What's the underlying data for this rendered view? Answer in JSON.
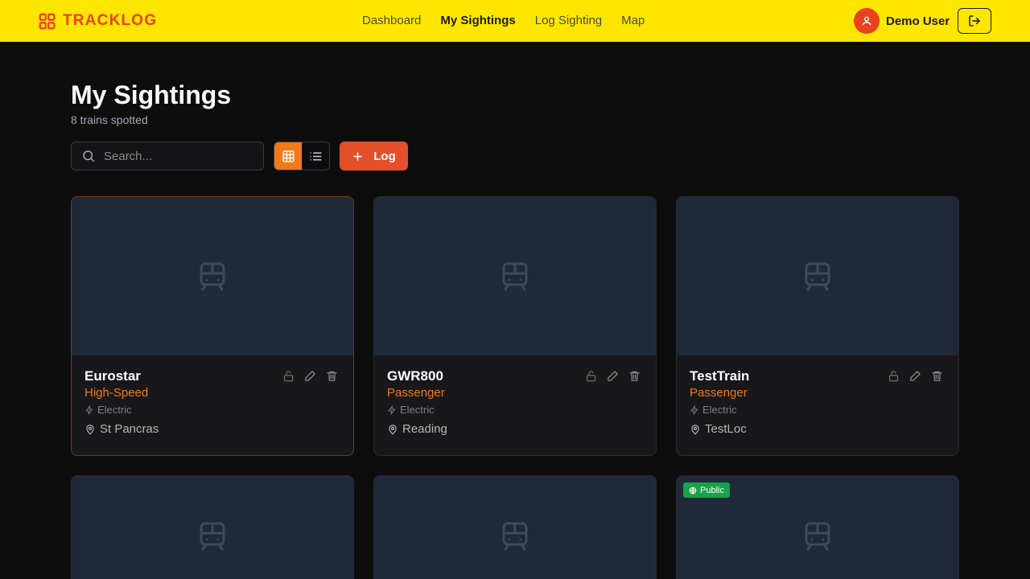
{
  "app": {
    "name": "TRACKLOG"
  },
  "nav": [
    {
      "label": "Dashboard",
      "active": false
    },
    {
      "label": "My Sightings",
      "active": true
    },
    {
      "label": "Log Sighting",
      "active": false
    },
    {
      "label": "Map",
      "active": false
    }
  ],
  "user": {
    "name": "Demo User"
  },
  "page": {
    "title": "My Sightings",
    "subtitle": "8 trains spotted"
  },
  "toolbar": {
    "search_placeholder": "Search...",
    "log_label": "Log",
    "view_mode": "grid"
  },
  "cards": [
    {
      "name": "Eurostar",
      "category": "High-Speed",
      "power": "Electric",
      "location": "St Pancras"
    },
    {
      "name": "GWR800",
      "category": "Passenger",
      "power": "Electric",
      "location": "Reading"
    },
    {
      "name": "TestTrain",
      "category": "Passenger",
      "power": "Electric",
      "location": "TestLoc"
    },
    {
      "badge": ""
    },
    {
      "badge": ""
    },
    {
      "badge": "Public"
    }
  ],
  "colors": {
    "topbar": "#ffe600",
    "brand": "#e8421e",
    "accent": "#f07a1a",
    "log_button": "#e4502a",
    "public_badge": "#16a34a",
    "card_image": "#1f2937"
  }
}
